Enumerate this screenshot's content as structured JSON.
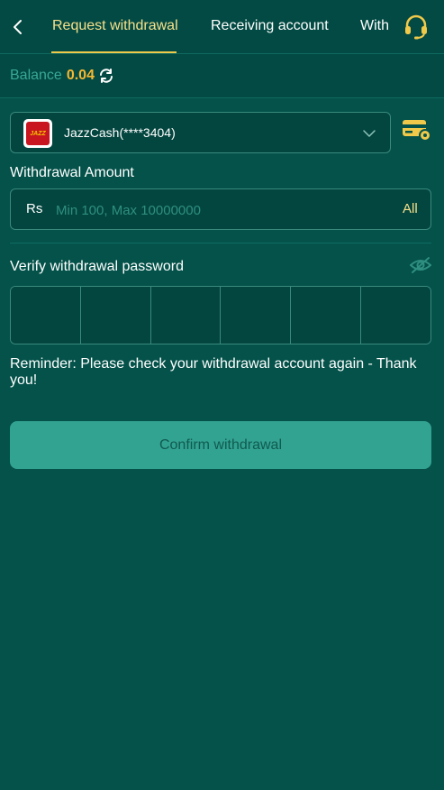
{
  "header": {
    "tabs": [
      {
        "label": "Request withdrawal",
        "active": true
      },
      {
        "label": "Receiving account",
        "active": false
      },
      {
        "label": "With",
        "active": false
      }
    ],
    "icons": {
      "back": "chevron-left-icon",
      "support": "headset-icon"
    }
  },
  "balance": {
    "label": "Balance",
    "value": "0.04",
    "refresh_icon": "refresh-icon"
  },
  "account": {
    "name": "JazzCash(****3404)",
    "logo_text": "JAZZ",
    "dropdown_icon": "chevron-down-icon",
    "settings_icon": "card-settings-icon"
  },
  "amount": {
    "label": "Withdrawal Amount",
    "currency": "Rs",
    "placeholder": "Min 100, Max 10000000",
    "value": "",
    "all_label": "All"
  },
  "password": {
    "label": "Verify withdrawal password",
    "visibility_icon": "eye-off-icon",
    "digits": [
      "",
      "",
      "",
      "",
      "",
      ""
    ]
  },
  "reminder": "Reminder: Please check your withdrawal account again - Thank you!",
  "confirm_label": "Confirm withdrawal",
  "colors": {
    "background": "#04524a",
    "accent": "#f7e08a",
    "balance_value": "#f7b731",
    "button": "#33a391"
  }
}
